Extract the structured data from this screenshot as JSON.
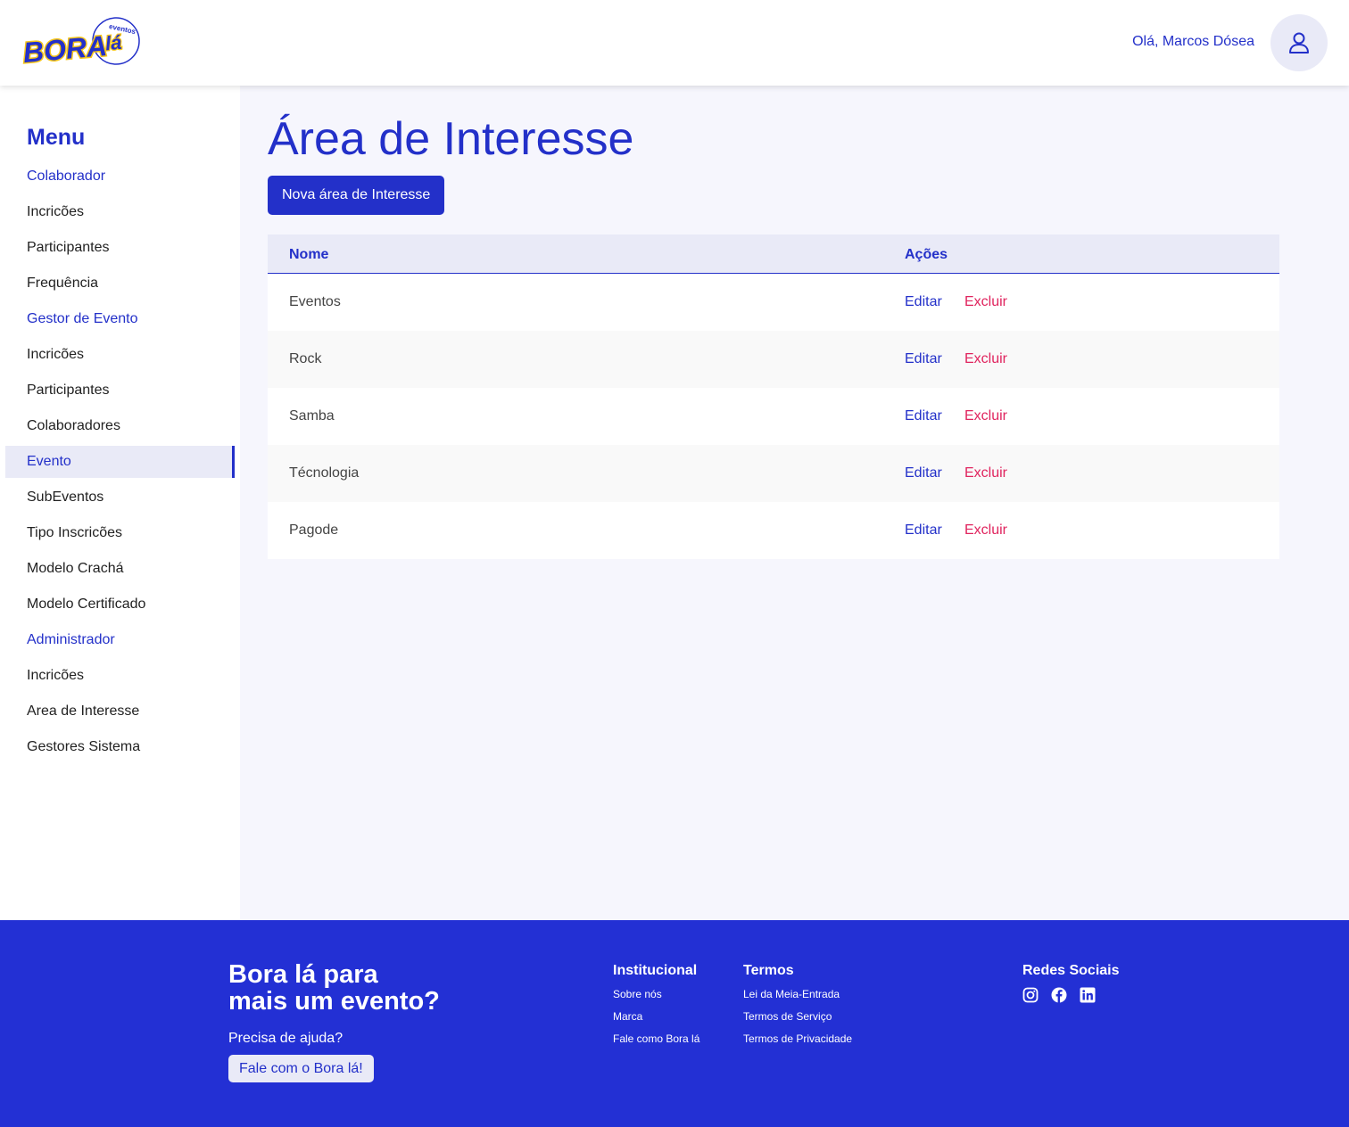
{
  "header": {
    "logo_text": "BORAlá",
    "logo_sub": "eventos",
    "greeting": "Olá, Marcos Dósea",
    "avatar_icon": "user-icon"
  },
  "sidebar": {
    "title": "Menu",
    "items": [
      {
        "label": "Colaborador",
        "type": "section"
      },
      {
        "label": "Incricões",
        "type": "item"
      },
      {
        "label": "Participantes",
        "type": "item"
      },
      {
        "label": "Frequência",
        "type": "item"
      },
      {
        "label": "Gestor de Evento",
        "type": "section"
      },
      {
        "label": "Incricões",
        "type": "item"
      },
      {
        "label": "Participantes",
        "type": "item"
      },
      {
        "label": "Colaboradores",
        "type": "item"
      },
      {
        "label": "Evento",
        "type": "active"
      },
      {
        "label": "SubEventos",
        "type": "item"
      },
      {
        "label": "Tipo Inscricões",
        "type": "item"
      },
      {
        "label": "Modelo Crachá",
        "type": "item"
      },
      {
        "label": "Modelo Certificado",
        "type": "item"
      },
      {
        "label": "Administrador",
        "type": "section"
      },
      {
        "label": "Incricões",
        "type": "item"
      },
      {
        "label": "Area de Interesse",
        "type": "item"
      },
      {
        "label": "Gestores Sistema",
        "type": "item"
      }
    ]
  },
  "main": {
    "title": "Área de Interesse",
    "new_button": "Nova área de Interesse",
    "table": {
      "headers": {
        "name": "Nome",
        "actions": "Ações"
      },
      "edit_label": "Editar",
      "delete_label": "Excluir",
      "rows": [
        {
          "name": "Eventos"
        },
        {
          "name": "Rock"
        },
        {
          "name": "Samba"
        },
        {
          "name": "Técnologia"
        },
        {
          "name": "Pagode"
        }
      ]
    }
  },
  "footer": {
    "tagline_1": "Bora lá para",
    "tagline_2": "mais um evento?",
    "help_text": "Precisa de ajuda?",
    "help_button": "Fale com o Bora lá!",
    "institucional": {
      "title": "Institucional",
      "links": [
        "Sobre nós",
        "Marca",
        "Fale como Bora lá"
      ]
    },
    "termos": {
      "title": "Termos",
      "links": [
        "Lei da Meia-Entrada",
        "Termos de Serviço",
        "Termos de Privacidade"
      ]
    },
    "redes": {
      "title": "Redes Sociais",
      "icons": [
        "instagram-icon",
        "facebook-icon",
        "linkedin-icon"
      ]
    }
  },
  "colors": {
    "primary": "#2330c9",
    "footer_bg": "#2330d4",
    "danger": "#e0245e",
    "logo_yellow": "#f5c518"
  }
}
